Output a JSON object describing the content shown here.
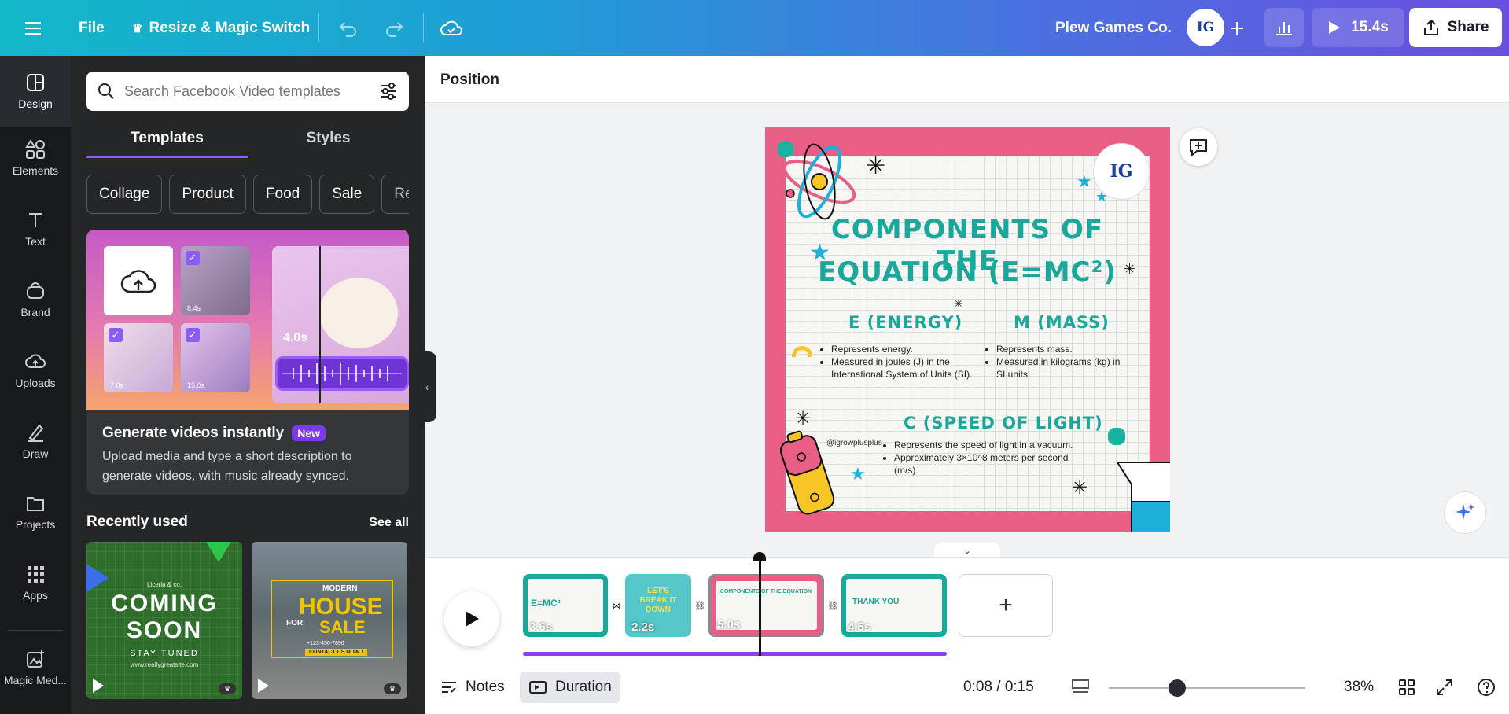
{
  "topbar": {
    "file_label": "File",
    "resize_label": "Resize & Magic Switch",
    "team_name": "Plew Games Co.",
    "avatar_initials": "IG",
    "play_duration": "15.4s",
    "share_label": "Share"
  },
  "rail": [
    {
      "label": "Design",
      "icon": "design-icon"
    },
    {
      "label": "Elements",
      "icon": "elements-icon"
    },
    {
      "label": "Text",
      "icon": "text-icon"
    },
    {
      "label": "Brand",
      "icon": "brand-icon"
    },
    {
      "label": "Uploads",
      "icon": "uploads-icon"
    },
    {
      "label": "Draw",
      "icon": "draw-icon"
    },
    {
      "label": "Projects",
      "icon": "projects-icon"
    },
    {
      "label": "Apps",
      "icon": "apps-icon"
    },
    {
      "label": "Magic Med...",
      "icon": "magic-media-icon"
    }
  ],
  "panel": {
    "search_placeholder": "Search Facebook Video templates",
    "tabs": [
      "Templates",
      "Styles"
    ],
    "chips": [
      "Collage",
      "Product",
      "Food",
      "Sale",
      "Re"
    ],
    "promo": {
      "art_durations": [
        "8.4s",
        "7.0s",
        "15.0s",
        "4.0s"
      ],
      "title": "Generate videos instantly",
      "badge": "New",
      "description": "Upload media and type a short description to generate videos, with music already synced."
    },
    "recent_heading": "Recently used",
    "see_all": "See all",
    "recent": [
      {
        "brand": "Liceria & co.",
        "line1": "COMING",
        "line2": "SOON",
        "line3": "STAY TUNED",
        "url": "www.reallygreatsite.com"
      },
      {
        "line1": "MODERN",
        "line2": "HOUSE",
        "line3": "FOR",
        "line4": "SALE",
        "phone": "+123-456-7890",
        "cta": "CONTACT US NOW !"
      }
    ]
  },
  "toolbar": {
    "position_label": "Position"
  },
  "design": {
    "title_line1": "COMPONENTS OF THE",
    "title_line2": "EQUATION (E=MC²)",
    "logo": "IG",
    "energy": {
      "heading": "E (ENERGY)",
      "points": [
        "Represents energy.",
        "Measured in joules (J) in the International System of Units (SI)."
      ]
    },
    "mass": {
      "heading": "M (MASS)",
      "points": [
        "Represents mass.",
        "Measured in kilograms (kg) in SI units."
      ]
    },
    "light": {
      "heading": "C (SPEED OF LIGHT)",
      "points": [
        "Represents the speed of light in a vacuum.",
        "Approximately 3×10^8 meters per second (m/s)."
      ]
    },
    "handle": "@igrowplusplus"
  },
  "timeline": {
    "clips": [
      {
        "duration": "3.6s",
        "label": "E=MC²"
      },
      {
        "duration": "2.2s",
        "label": "LET'S BREAK IT DOWN"
      },
      {
        "duration": "5.0s",
        "label": "COMPONENTS OF THE EQUATION"
      },
      {
        "duration": "4.5s",
        "label": "THANK YOU"
      }
    ],
    "progress_fraction": 0.53
  },
  "bottombar": {
    "notes_label": "Notes",
    "duration_label": "Duration",
    "time": "0:08 / 0:15",
    "zoom": "38%"
  },
  "colors": {
    "accent": "#8b3ff0",
    "design_border": "#e85e84",
    "design_teal": "#1aa79c"
  }
}
